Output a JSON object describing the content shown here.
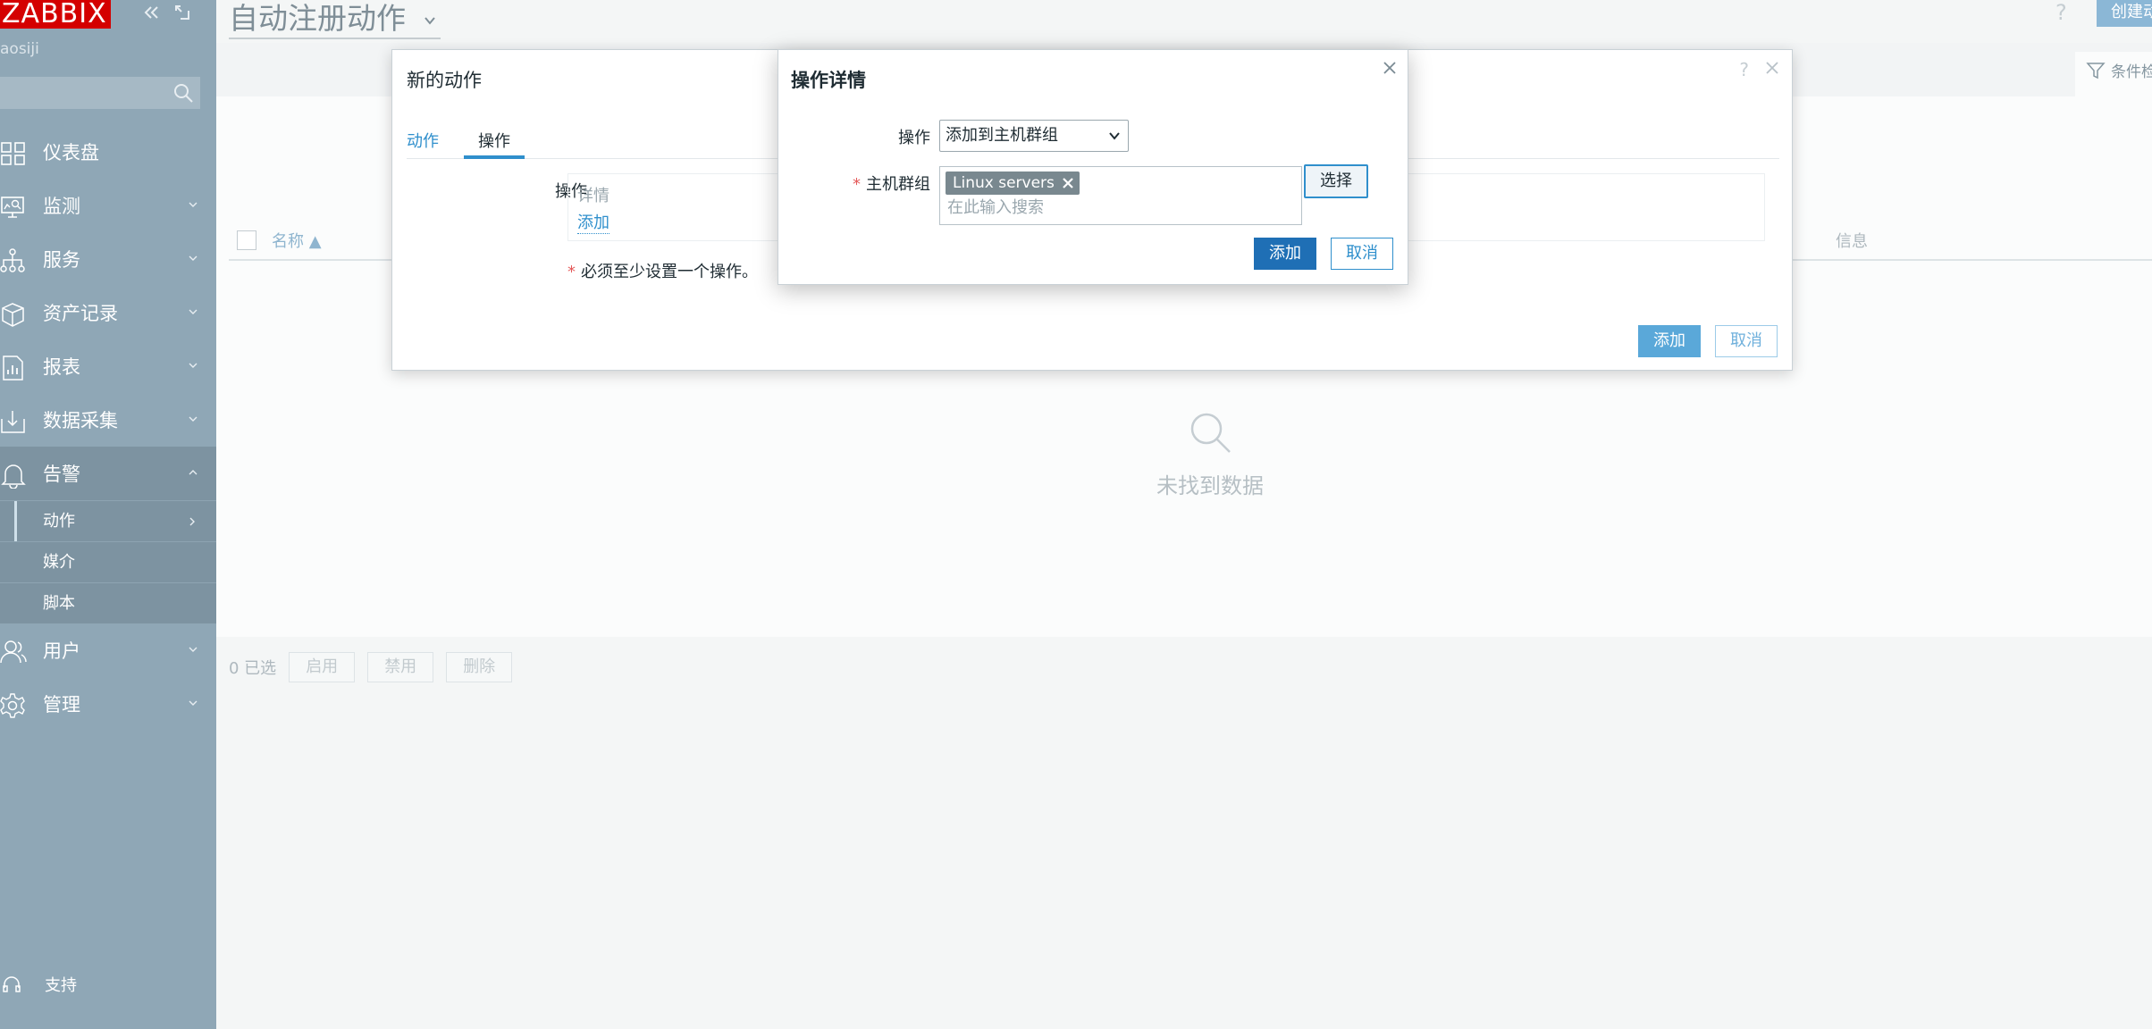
{
  "app": {
    "logo": "ZABBIX",
    "server_name": "aosiji"
  },
  "sidebar": {
    "items": [
      {
        "label": "仪表盘",
        "icon": "dashboard-icon"
      },
      {
        "label": "监测",
        "icon": "monitoring-icon"
      },
      {
        "label": "服务",
        "icon": "services-icon"
      },
      {
        "label": "资产记录",
        "icon": "inventory-icon"
      },
      {
        "label": "报表",
        "icon": "reports-icon"
      },
      {
        "label": "数据采集",
        "icon": "data-collection-icon"
      },
      {
        "label": "告警",
        "icon": "alerts-icon"
      },
      {
        "label": "用户",
        "icon": "users-icon"
      },
      {
        "label": "管理",
        "icon": "administration-icon"
      }
    ],
    "sub_items": [
      {
        "label": "动作"
      },
      {
        "label": "媒介"
      },
      {
        "label": "脚本"
      }
    ],
    "support": "支持"
  },
  "header": {
    "title": "自动注册动作",
    "help": "?",
    "create_button": "创建动作"
  },
  "filter": {
    "label": "条件检"
  },
  "table": {
    "col_name": "名称 ▲",
    "col_info": "信息",
    "empty_text": "未找到数据"
  },
  "footer": {
    "selected": "0 已选",
    "enable": "启用",
    "disable": "禁用",
    "delete": "删除"
  },
  "action_dialog": {
    "title": "新的动作",
    "help": "?",
    "tabs": [
      "动作",
      "操作"
    ],
    "operations_label": "操作",
    "details_header": "详情",
    "add_link": "添加",
    "note": "必须至少设置一个操作。",
    "add_button": "添加",
    "cancel_button": "取消"
  },
  "operation_dialog": {
    "title": "操作详情",
    "operation_label": "操作",
    "operation_value": "添加到主机群组",
    "host_group_label": "主机群组",
    "host_group_chip": "Linux servers",
    "search_placeholder": "在此输入搜索",
    "select_button": "选择",
    "add_button": "添加",
    "cancel_button": "取消"
  },
  "colors": {
    "sidebar": "#8fa7b6",
    "brand_red": "#d40000",
    "accent_blue": "#2f8fcc",
    "primary_button": "#1f6fb5",
    "required": "#e45959"
  }
}
